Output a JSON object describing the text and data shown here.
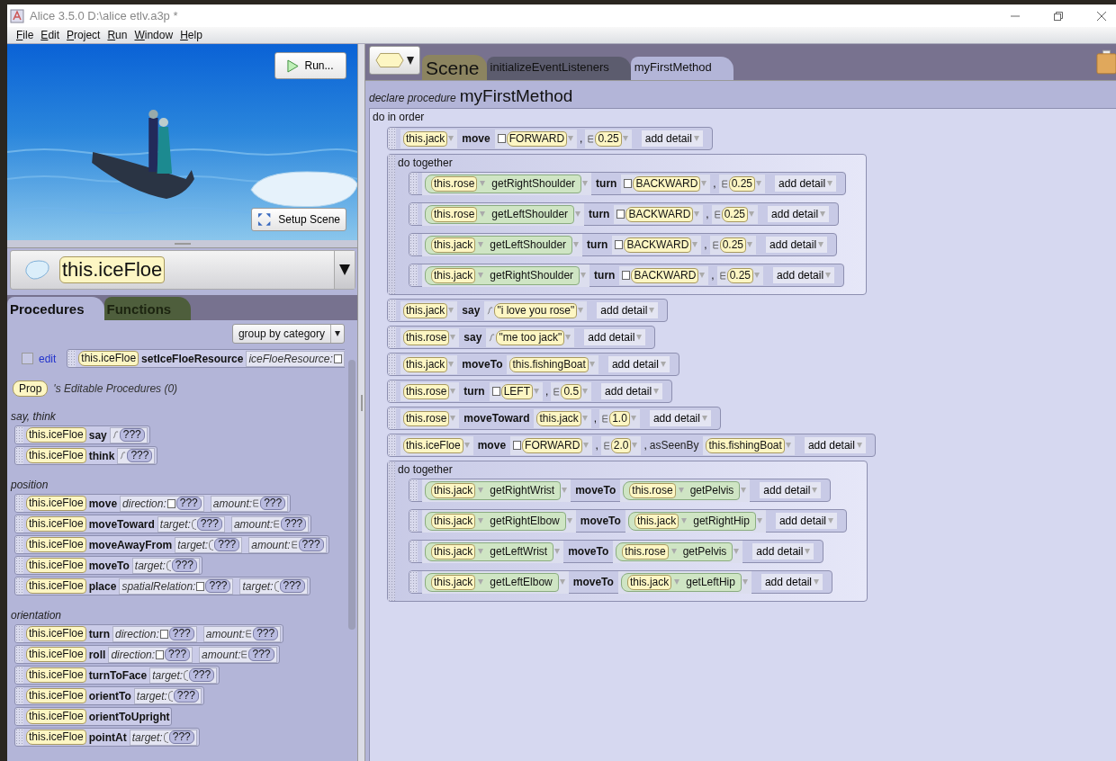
{
  "window": {
    "title": "Alice 3.5.0 D:\\alice etlv.a3p *"
  },
  "menu": [
    "File",
    "Edit",
    "Project",
    "Run",
    "Window",
    "Help"
  ],
  "scene": {
    "run_button": "Run...",
    "setup_button": "Setup Scene"
  },
  "object_selector": {
    "value": "this.iceFloe"
  },
  "palette_tabs": [
    {
      "label": "Procedures",
      "selected": true
    },
    {
      "label": "Functions",
      "selected": false
    }
  ],
  "group_dropdown": {
    "value": "group by category"
  },
  "edit_row": {
    "checked": false,
    "link": "edit",
    "tile": {
      "object": "this.iceFloe",
      "method": "setIceFloeResource",
      "params": [
        {
          "label": "iceFloeResource:",
          "kind": "enum"
        }
      ]
    }
  },
  "editable": {
    "type": "Prop",
    "label": "'s Editable Procedures (0)"
  },
  "categories": [
    {
      "title": "say, think",
      "tiles": [
        {
          "object": "this.iceFloe",
          "method": "say",
          "params": [
            {
              "kind": "str",
              "value": "???"
            }
          ]
        },
        {
          "object": "this.iceFloe",
          "method": "think",
          "params": [
            {
              "kind": "str",
              "value": "???"
            }
          ]
        }
      ]
    },
    {
      "title": "position",
      "tiles": [
        {
          "object": "this.iceFloe",
          "method": "move",
          "params": [
            {
              "label": "direction:",
              "kind": "enum",
              "value": "???"
            },
            {
              "label": "amount:",
              "kind": "num",
              "value": "???"
            }
          ]
        },
        {
          "object": "this.iceFloe",
          "method": "moveToward",
          "params": [
            {
              "label": "target:",
              "kind": "obj",
              "value": "???"
            },
            {
              "label": "amount:",
              "kind": "num",
              "value": "???"
            }
          ]
        },
        {
          "object": "this.iceFloe",
          "method": "moveAwayFrom",
          "params": [
            {
              "label": "target:",
              "kind": "obj",
              "value": "???"
            },
            {
              "label": "amount:",
              "kind": "num",
              "value": "???"
            }
          ]
        },
        {
          "object": "this.iceFloe",
          "method": "moveTo",
          "params": [
            {
              "label": "target:",
              "kind": "obj",
              "value": "???"
            }
          ]
        },
        {
          "object": "this.iceFloe",
          "method": "place",
          "params": [
            {
              "label": "spatialRelation:",
              "kind": "enum",
              "value": "???"
            },
            {
              "label": "target:",
              "kind": "obj",
              "value": "???"
            }
          ]
        }
      ]
    },
    {
      "title": "orientation",
      "tiles": [
        {
          "object": "this.iceFloe",
          "method": "turn",
          "params": [
            {
              "label": "direction:",
              "kind": "enum",
              "value": "???"
            },
            {
              "label": "amount:",
              "kind": "num",
              "value": "???"
            }
          ]
        },
        {
          "object": "this.iceFloe",
          "method": "roll",
          "params": [
            {
              "label": "direction:",
              "kind": "enum",
              "value": "???"
            },
            {
              "label": "amount:",
              "kind": "num",
              "value": "???"
            }
          ]
        },
        {
          "object": "this.iceFloe",
          "method": "turnToFace",
          "params": [
            {
              "label": "target:",
              "kind": "obj",
              "value": "???"
            }
          ]
        },
        {
          "object": "this.iceFloe",
          "method": "orientTo",
          "params": [
            {
              "label": "target:",
              "kind": "obj",
              "value": "???"
            }
          ]
        },
        {
          "object": "this.iceFloe",
          "method": "orientToUpright"
        },
        {
          "object": "this.iceFloe",
          "method": "pointAt",
          "params": [
            {
              "label": "target:",
              "kind": "obj",
              "value": "???"
            }
          ]
        }
      ]
    }
  ],
  "editor_tabs": [
    {
      "label": "Scene",
      "kind": "class",
      "selected": false
    },
    {
      "label": "initializeEventListeners",
      "kind": "method",
      "selected": false
    },
    {
      "label": "myFirstMethod",
      "kind": "method",
      "selected": true
    }
  ],
  "declaration": {
    "keyword": "declare procedure",
    "name": "myFirstMethod"
  },
  "body": {
    "label": "do in order",
    "statements": [
      {
        "kind": "stmt",
        "parts": [
          {
            "kind": "obj",
            "text": "this.jack"
          },
          {
            "kind": "method",
            "text": "move"
          },
          {
            "kind": "enum",
            "text": "FORWARD"
          },
          {
            "kind": "sep",
            "text": ","
          },
          {
            "kind": "num",
            "text": "0.25"
          },
          {
            "kind": "detail",
            "text": "add detail"
          }
        ]
      },
      {
        "kind": "together",
        "label": "do together",
        "children": [
          {
            "kind": "stmt",
            "parts": [
              {
                "kind": "joint",
                "obj": "this.rose",
                "text": "getRightShoulder"
              },
              {
                "kind": "method",
                "text": "turn"
              },
              {
                "kind": "enum",
                "text": "BACKWARD"
              },
              {
                "kind": "sep",
                "text": ","
              },
              {
                "kind": "num",
                "text": "0.25"
              },
              {
                "kind": "detail",
                "text": "add detail"
              }
            ]
          },
          {
            "kind": "stmt",
            "parts": [
              {
                "kind": "joint",
                "obj": "this.rose",
                "text": "getLeftShoulder"
              },
              {
                "kind": "method",
                "text": "turn"
              },
              {
                "kind": "enum",
                "text": "BACKWARD"
              },
              {
                "kind": "sep",
                "text": ","
              },
              {
                "kind": "num",
                "text": "0.25"
              },
              {
                "kind": "detail",
                "text": "add detail"
              }
            ]
          },
          {
            "kind": "stmt",
            "parts": [
              {
                "kind": "joint",
                "obj": "this.jack",
                "text": "getLeftShoulder"
              },
              {
                "kind": "method",
                "text": "turn"
              },
              {
                "kind": "enum",
                "text": "BACKWARD"
              },
              {
                "kind": "sep",
                "text": ","
              },
              {
                "kind": "num",
                "text": "0.25"
              },
              {
                "kind": "detail",
                "text": "add detail"
              }
            ]
          },
          {
            "kind": "stmt",
            "parts": [
              {
                "kind": "joint",
                "obj": "this.jack",
                "text": "getRightShoulder"
              },
              {
                "kind": "method",
                "text": "turn"
              },
              {
                "kind": "enum",
                "text": "BACKWARD"
              },
              {
                "kind": "sep",
                "text": ","
              },
              {
                "kind": "num",
                "text": "0.25"
              },
              {
                "kind": "detail",
                "text": "add detail"
              }
            ]
          }
        ]
      },
      {
        "kind": "stmt",
        "parts": [
          {
            "kind": "obj",
            "text": "this.jack"
          },
          {
            "kind": "method",
            "text": "say"
          },
          {
            "kind": "str",
            "text": "\"i love you rose\""
          },
          {
            "kind": "detail",
            "text": "add detail"
          }
        ]
      },
      {
        "kind": "stmt",
        "parts": [
          {
            "kind": "obj",
            "text": "this.rose"
          },
          {
            "kind": "method",
            "text": "say"
          },
          {
            "kind": "str",
            "text": "\"me too jack\""
          },
          {
            "kind": "detail",
            "text": "add detail"
          }
        ]
      },
      {
        "kind": "stmt",
        "parts": [
          {
            "kind": "obj",
            "text": "this.jack"
          },
          {
            "kind": "method",
            "text": "moveTo"
          },
          {
            "kind": "obj",
            "text": "this.fishingBoat"
          },
          {
            "kind": "detail",
            "text": "add detail"
          }
        ]
      },
      {
        "kind": "stmt",
        "parts": [
          {
            "kind": "obj",
            "text": "this.rose"
          },
          {
            "kind": "method",
            "text": "turn"
          },
          {
            "kind": "enum",
            "text": "LEFT"
          },
          {
            "kind": "sep",
            "text": ","
          },
          {
            "kind": "num",
            "text": "0.5"
          },
          {
            "kind": "detail",
            "text": "add detail"
          }
        ]
      },
      {
        "kind": "stmt",
        "parts": [
          {
            "kind": "obj",
            "text": "this.rose"
          },
          {
            "kind": "method",
            "text": "moveToward"
          },
          {
            "kind": "obj",
            "text": "this.jack"
          },
          {
            "kind": "sep",
            "text": ","
          },
          {
            "kind": "num",
            "text": "1.0"
          },
          {
            "kind": "detail",
            "text": "add detail"
          }
        ]
      },
      {
        "kind": "stmt",
        "parts": [
          {
            "kind": "obj",
            "text": "this.iceFloe"
          },
          {
            "kind": "method",
            "text": "move"
          },
          {
            "kind": "enum",
            "text": "FORWARD"
          },
          {
            "kind": "sep",
            "text": ","
          },
          {
            "kind": "num",
            "text": "2.0"
          },
          {
            "kind": "sep",
            "text": ","
          },
          {
            "kind": "word",
            "text": "asSeenBy"
          },
          {
            "kind": "obj",
            "text": "this.fishingBoat"
          },
          {
            "kind": "detail",
            "text": "add detail"
          }
        ]
      },
      {
        "kind": "together",
        "label": "do together",
        "children": [
          {
            "kind": "stmt",
            "parts": [
              {
                "kind": "joint",
                "obj": "this.jack",
                "text": "getRightWrist"
              },
              {
                "kind": "method",
                "text": "moveTo"
              },
              {
                "kind": "joint",
                "obj": "this.rose",
                "text": "getPelvis"
              },
              {
                "kind": "detail",
                "text": "add detail"
              }
            ]
          },
          {
            "kind": "stmt",
            "parts": [
              {
                "kind": "joint",
                "obj": "this.jack",
                "text": "getRightElbow"
              },
              {
                "kind": "method",
                "text": "moveTo"
              },
              {
                "kind": "joint",
                "obj": "this.jack",
                "text": "getRightHip"
              },
              {
                "kind": "detail",
                "text": "add detail"
              }
            ]
          },
          {
            "kind": "stmt",
            "parts": [
              {
                "kind": "joint",
                "obj": "this.jack",
                "text": "getLeftWrist"
              },
              {
                "kind": "method",
                "text": "moveTo"
              },
              {
                "kind": "joint",
                "obj": "this.rose",
                "text": "getPelvis"
              },
              {
                "kind": "detail",
                "text": "add detail"
              }
            ]
          },
          {
            "kind": "stmt",
            "parts": [
              {
                "kind": "joint",
                "obj": "this.jack",
                "text": "getLeftElbow"
              },
              {
                "kind": "method",
                "text": "moveTo"
              },
              {
                "kind": "joint",
                "obj": "this.jack",
                "text": "getLeftHip"
              },
              {
                "kind": "detail",
                "text": "add detail"
              }
            ]
          }
        ]
      }
    ]
  }
}
